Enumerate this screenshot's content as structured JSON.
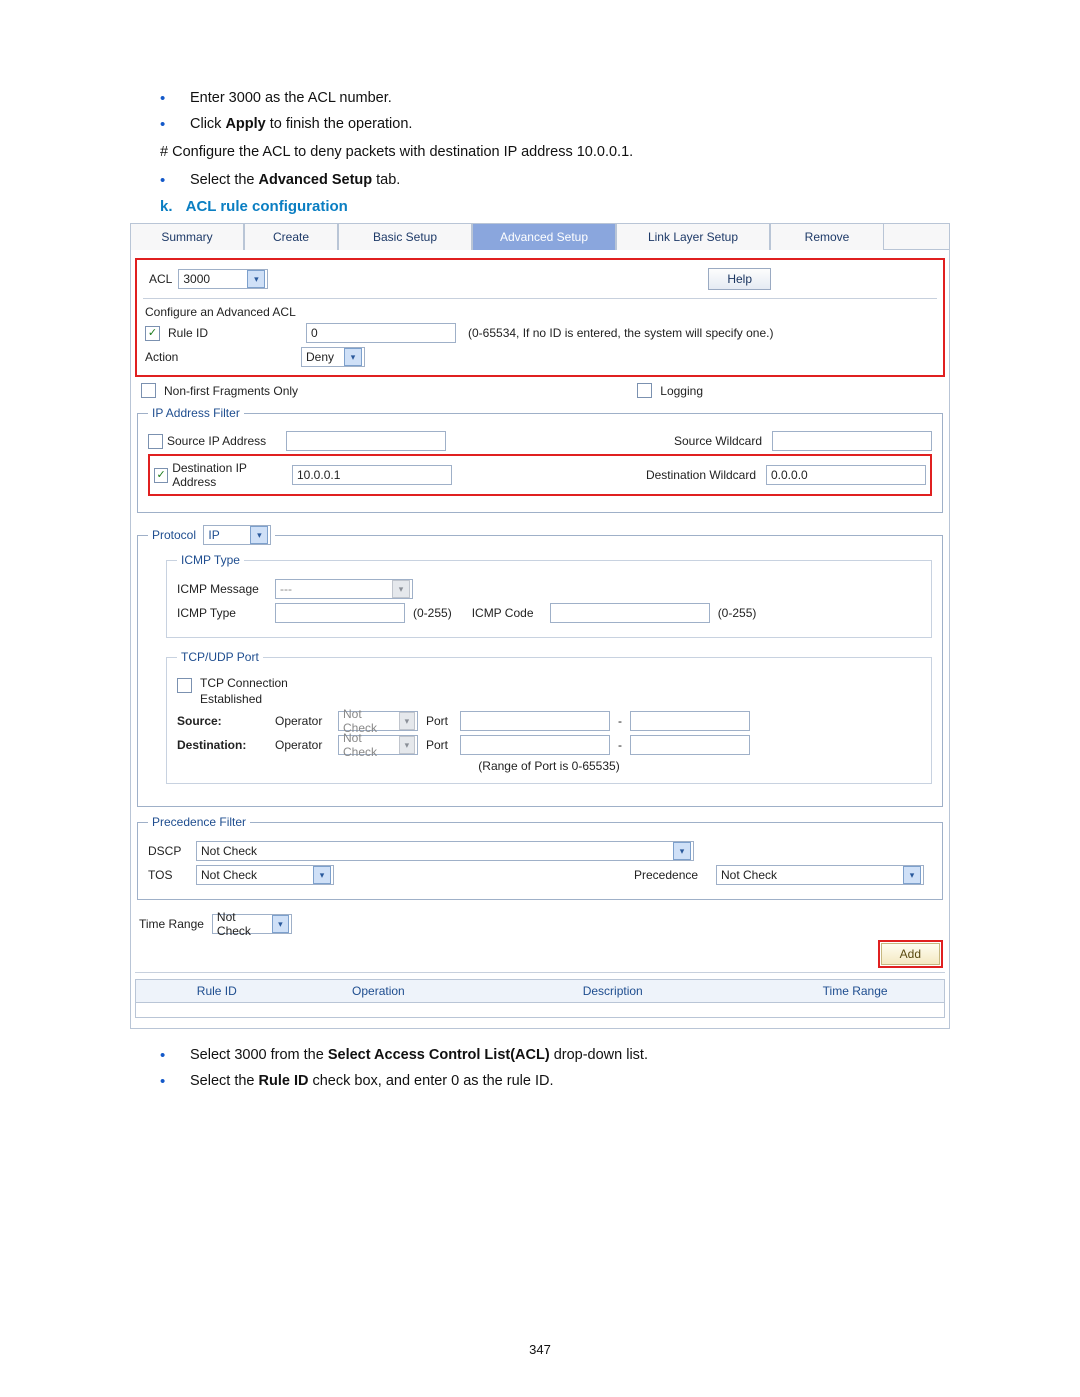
{
  "intro": {
    "bullets": [
      {
        "prefix": "Enter 3000 as the ACL number."
      },
      {
        "prefix_a": "Click ",
        "bold": "Apply",
        "suffix": " to finish the operation."
      }
    ],
    "hash_line": "# Configure the ACL to deny packets with destination IP address 10.0.0.1.",
    "bullet3_a": "Select the ",
    "bullet3_bold": "Advanced Setup",
    "bullet3_b": " tab."
  },
  "heading": {
    "letter": "k.",
    "text": "ACL rule configuration"
  },
  "tabs": [
    "Summary",
    "Create",
    "Basic Setup",
    "Advanced Setup",
    "Link Layer Setup",
    "Remove"
  ],
  "acl": {
    "label": "ACL",
    "value": "3000",
    "help_btn": "Help"
  },
  "config_title": "Configure an Advanced ACL",
  "rule_id_label": "Rule ID",
  "rule_id_value": "0",
  "rule_id_hint": "(0-65534, If no ID is entered, the system will specify one.)",
  "action_label": "Action",
  "action_value": "Deny",
  "nonfirst_label": "Non-first Fragments Only",
  "logging_label": "Logging",
  "ip_filter": {
    "legend": "IP Address Filter",
    "src_label": "Source IP Address",
    "src_wc_label": "Source Wildcard",
    "dst_label": "Destination IP Address",
    "dst_value": "10.0.0.1",
    "dst_wc_label": "Destination Wildcard",
    "dst_wc_value": "0.0.0.0"
  },
  "protocol_label": "Protocol",
  "protocol_value": "IP",
  "icmp": {
    "legend": "ICMP Type",
    "msg_label": "ICMP Message",
    "msg_value": "---",
    "type_label": "ICMP Type",
    "type_range": "(0-255)",
    "code_label": "ICMP Code",
    "code_range": "(0-255)"
  },
  "tcpudp": {
    "legend": "TCP/UDP Port",
    "conn_label": "TCP Connection Established",
    "src_lbl": "Source:",
    "dst_lbl": "Destination:",
    "operator_lbl": "Operator",
    "not_check": "Not Check",
    "port_lbl": "Port",
    "dash": "-",
    "range_note": "(Range of Port is 0-65535)"
  },
  "prec": {
    "legend": "Precedence Filter",
    "dscp_lbl": "DSCP",
    "dscp_val": "Not Check",
    "tos_lbl": "TOS",
    "tos_val": "Not Check",
    "prec_lbl": "Precedence",
    "prec_val": "Not Check"
  },
  "time_range_lbl": "Time Range",
  "time_range_val": "Not Check",
  "add_btn": "Add",
  "table": {
    "cols": [
      "Rule ID",
      "Operation",
      "Description",
      "Time Range"
    ]
  },
  "bottom": {
    "b1_a": "Select 3000 from the ",
    "b1_bold": "Select Access Control List(ACL)",
    "b1_b": " drop-down list.",
    "b2_a": "Select the ",
    "b2_bold": "Rule ID",
    "b2_b": " check box, and enter 0 as the rule ID."
  },
  "page_number": "347"
}
